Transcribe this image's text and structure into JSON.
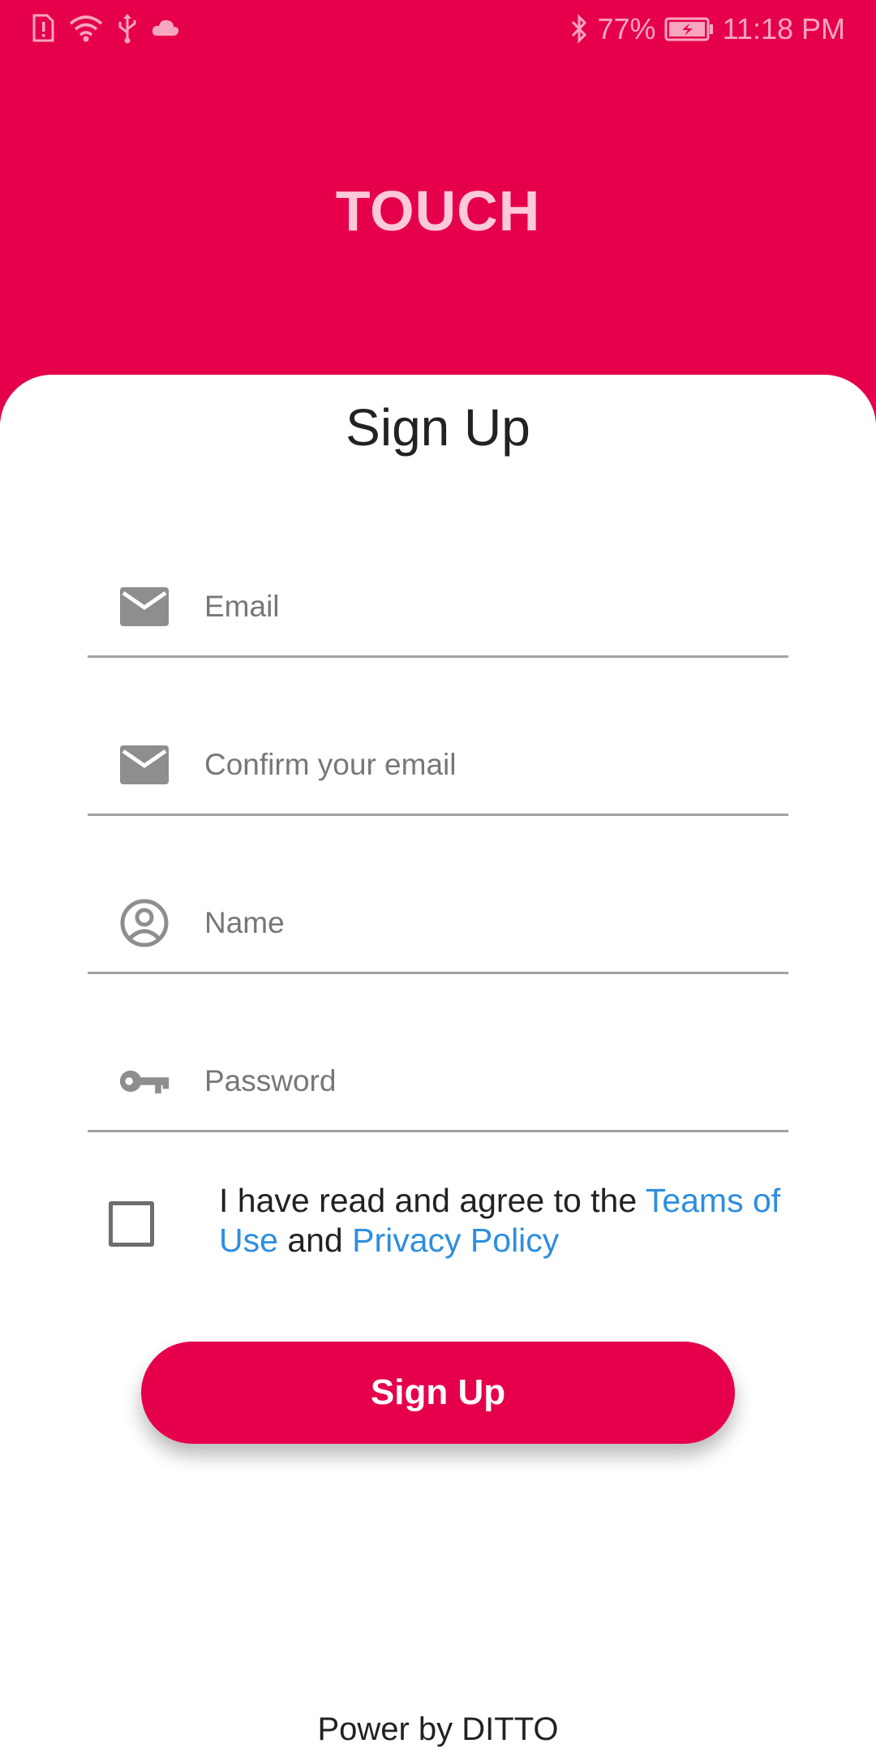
{
  "status_bar": {
    "battery_percent": "77%",
    "time": "11:18 PM",
    "icons": [
      "sim-alert-icon",
      "wifi-icon",
      "usb-icon",
      "cloud-icon",
      "bluetooth-icon",
      "battery-charging-icon"
    ]
  },
  "header": {
    "brand": "TOUCH",
    "color": "#E6004C"
  },
  "page_title": "Sign Up",
  "form": {
    "email": {
      "placeholder": "Email",
      "value": "",
      "icon": "mail-icon"
    },
    "confirm_email": {
      "placeholder": "Confirm your email",
      "value": "",
      "icon": "mail-icon"
    },
    "name": {
      "placeholder": "Name",
      "value": "",
      "icon": "account-circle-icon"
    },
    "password": {
      "placeholder": "Password",
      "value": "",
      "icon": "key-icon"
    }
  },
  "agreement": {
    "checked": false,
    "text_before": "I have read and agree to the ",
    "terms_link": "Teams of Use",
    "text_middle": " and ",
    "privacy_link": "Privacy Policy",
    "link_color": "#2D8EE0"
  },
  "signup_button": {
    "label": "Sign Up"
  },
  "footer": {
    "text": "Power by DITTO"
  }
}
